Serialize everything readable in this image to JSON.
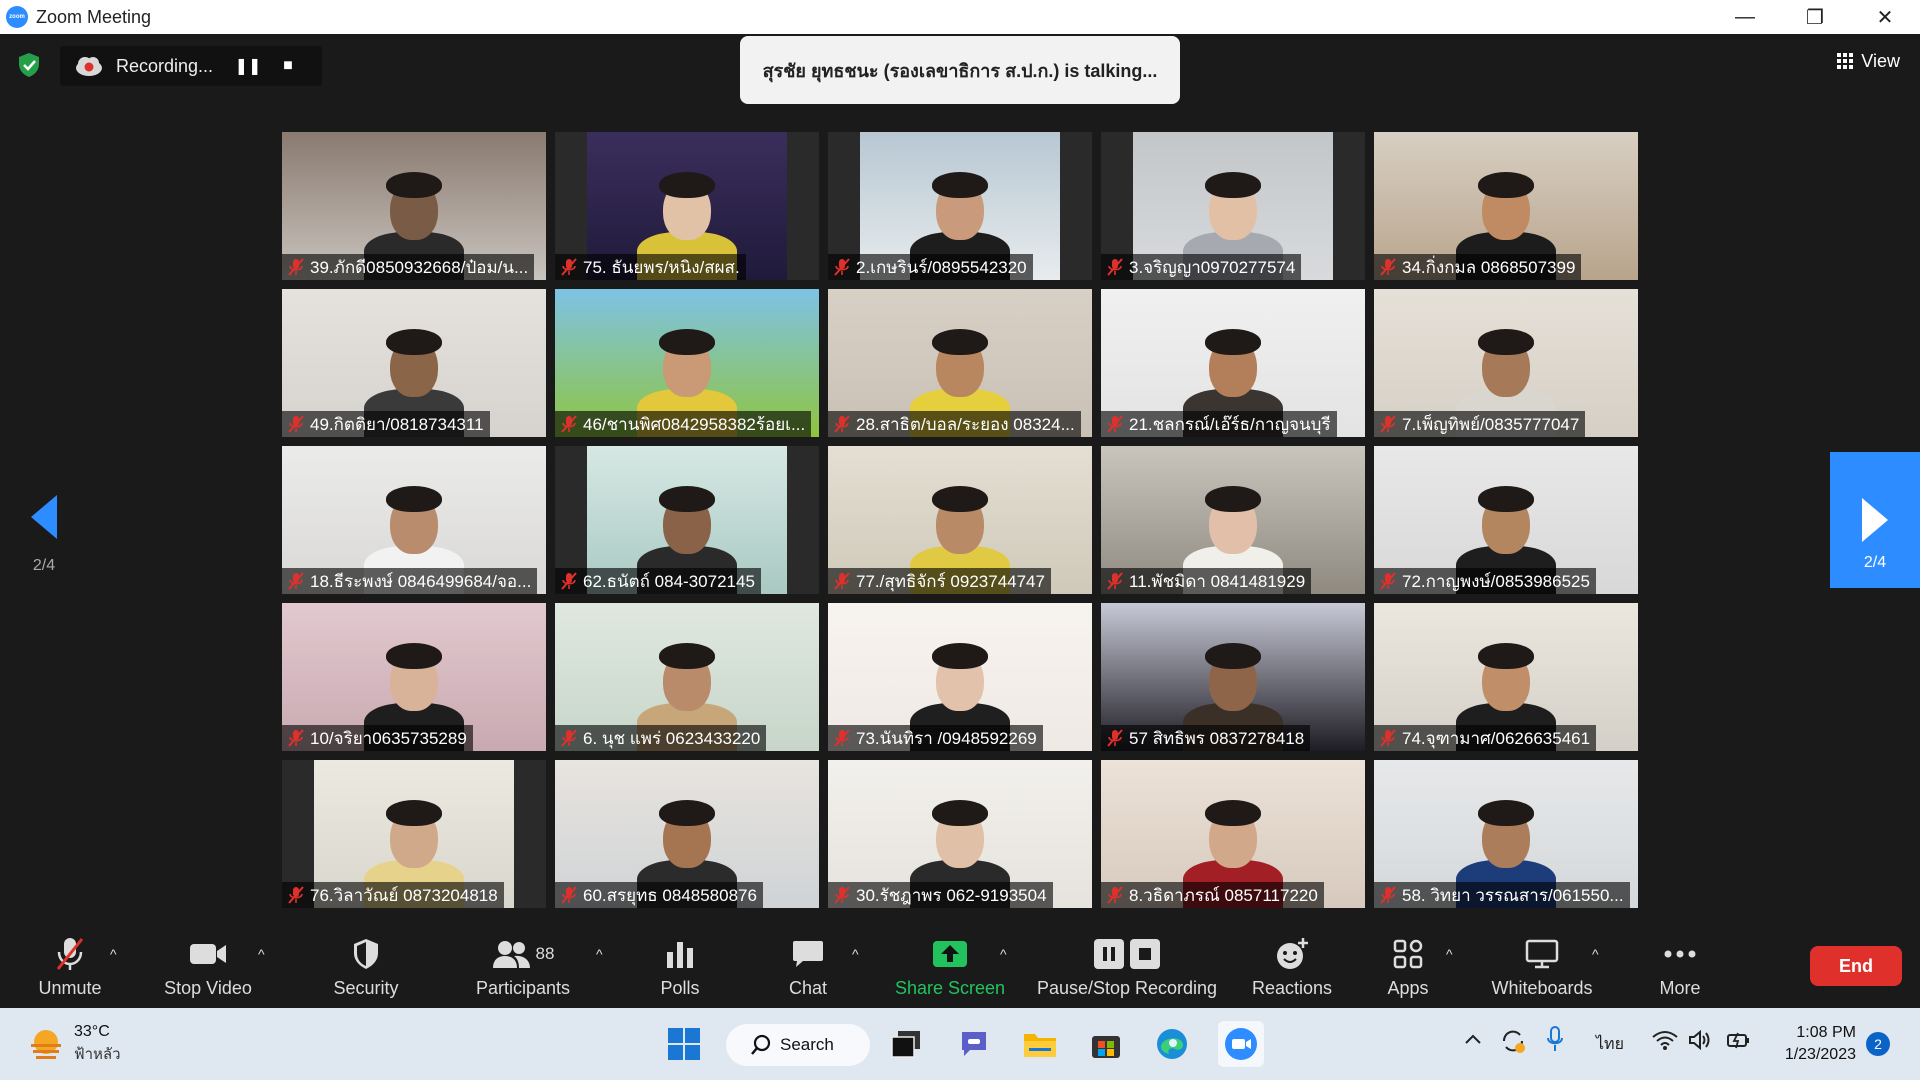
{
  "window": {
    "title": "Zoom Meeting",
    "app_icon_text": "zoom",
    "minimize": "—",
    "restore": "❐",
    "close": "✕"
  },
  "recording": {
    "label": "Recording...",
    "pause_glyph": "❚❚",
    "stop_glyph": "■"
  },
  "talking": "สุรชัย ยุทธชนะ (รองเลขาธิการ ส.ป.ก.) is talking...",
  "view_label": "View",
  "pagination": {
    "left_page": "2/4",
    "right_page": "2/4"
  },
  "participants": [
    {
      "name": "39.ภักดี0850932668/ป๋อม/น...",
      "bg": "#c9c4be",
      "wall": "#8a7a70",
      "skin": "#7a5b45",
      "shirt": "#2a2a2a"
    },
    {
      "name": "75. ธันยพร/หนิง/สผส.",
      "bg": "#1f1a3a",
      "wall": "#3b2e5c",
      "skin": "#e2c2a6",
      "shirt": "#d9c23a"
    },
    {
      "name": "2.เกษรินร์/0895542320",
      "bg": "#e8ecee",
      "wall": "#b7c7d2",
      "skin": "#c99a7c",
      "shirt": "#1d1d1d"
    },
    {
      "name": "3.จริญญา0970277574",
      "bg": "#d8dadc",
      "wall": "#c3c6c9",
      "skin": "#e2c0a6",
      "shirt": "#a6a9b0"
    },
    {
      "name": "34.กิ่งกมล 0868507399",
      "bg": "#b8a48c",
      "wall": "#d8cfc2",
      "skin": "#c08b62",
      "shirt": "#1c1c1c"
    },
    {
      "name": "49.กิตติยา/0818734311",
      "bg": "#d6d3cf",
      "wall": "#e5e2de",
      "skin": "#8a6548",
      "shirt": "#3a3a3a"
    },
    {
      "name": "46/ชานพิศ0842958382ร้อยเ...",
      "bg": "#8fc43f",
      "wall": "#7ec3e6",
      "skin": "#c99a75",
      "shirt": "#e2c83a"
    },
    {
      "name": "28.สาธิต/บอล/ระยอง 08324...",
      "bg": "#c9c1b5",
      "wall": "#d8d0c5",
      "skin": "#b8865f",
      "shirt": "#e5cf3c"
    },
    {
      "name": "21.ชลกรณ์/เอ๊ร์ธ/กาญจนบุรี",
      "bg": "#e3e3e3",
      "wall": "#f0f0f0",
      "skin": "#b27f5a",
      "shirt": "#3a3530"
    },
    {
      "name": "7.เพ็ญทิพย์/0835777047",
      "bg": "#d5cfc5",
      "wall": "#e6e1d8",
      "skin": "#a67a58",
      "shirt": "#d9d6cf"
    },
    {
      "name": "18.ธีระพงษ์ 0846499684/จอ...",
      "bg": "#d9d8d6",
      "wall": "#ebebea",
      "skin": "#b88c6c",
      "shirt": "#f2f2f2"
    },
    {
      "name": "62.ธนัตถ์ 084-3072145",
      "bg": "#a9c9c2",
      "wall": "#d6e8e4",
      "skin": "#8a6247",
      "shirt": "#2a2a2a"
    },
    {
      "name": "77./สุทธิจักร์ 0923744747",
      "bg": "#cfc9b9",
      "wall": "#e4dfd3",
      "skin": "#b98a66",
      "shirt": "#e0ca44"
    },
    {
      "name": "11.พัชมิดา 0841481929",
      "bg": "#8f8a80",
      "wall": "#c9c5bd",
      "skin": "#e1bfa8",
      "shirt": "#f0efe9"
    },
    {
      "name": "72.กาญพงษ์/0853986525",
      "bg": "#d8d8d8",
      "wall": "#e8e8e8",
      "skin": "#b38660",
      "shirt": "#1e1e1e"
    },
    {
      "name": "10/จริยา0635735289",
      "bg": "#c9a9b1",
      "wall": "#e2c9cf",
      "skin": "#d8b39a",
      "shirt": "#1e1e1e"
    },
    {
      "name": "6. นุช แพร่  0623433220",
      "bg": "#c7d6c9",
      "wall": "#e0e8e0",
      "skin": "#b98b6a",
      "shirt": "#c7a77a"
    },
    {
      "name": "73.นันทิรา /0948592269",
      "bg": "#efe9e4",
      "wall": "#f7f3ef",
      "skin": "#e2c2ab",
      "shirt": "#1f1f1f"
    },
    {
      "name": "57 สิทธิพร   0837278418",
      "bg": "#1e1c24",
      "wall": "#c7c9d6",
      "skin": "#8e6549",
      "shirt": "#3b3028"
    },
    {
      "name": "74.จุฑามาศ/0626635461",
      "bg": "#d4d0c8",
      "wall": "#ebe7df",
      "skin": "#c08e68",
      "shirt": "#1e1e1e"
    },
    {
      "name": "76.วิลาวัณย์ 0873204818",
      "bg": "#d9d6cc",
      "wall": "#ece9e1",
      "skin": "#cfa98a",
      "shirt": "#e6d28a"
    },
    {
      "name": "60.สรยุทธ 0848580876",
      "bg": "#cfd3d6",
      "wall": "#e8e4df",
      "skin": "#a57552",
      "shirt": "#2b2b2b"
    },
    {
      "name": "30.รัชฎาพร 062-9193504",
      "bg": "#e6e3de",
      "wall": "#f2f0ec",
      "skin": "#e0c0a6",
      "shirt": "#2a2a2a"
    },
    {
      "name": "8.วธิดาภรณ์ 0857117220",
      "bg": "#d7c9bd",
      "wall": "#ece2d8",
      "skin": "#d2a88a",
      "shirt": "#a11f25"
    },
    {
      "name": "58. วิทยา วรรณสาร/061550...",
      "bg": "#d5d8da",
      "wall": "#e6e8ea",
      "skin": "#ab7d5a",
      "shirt": "#1d3d7a"
    }
  ],
  "toolbar": {
    "unmute": "Unmute",
    "stop_video": "Stop Video",
    "security": "Security",
    "participants": "Participants",
    "participants_count": "88",
    "polls": "Polls",
    "chat": "Chat",
    "share_screen": "Share Screen",
    "pause_stop_recording": "Pause/Stop Recording",
    "reactions": "Reactions",
    "apps": "Apps",
    "whiteboards": "Whiteboards",
    "more": "More",
    "end": "End",
    "caret": "^",
    "share_color": "#22c35e",
    "end_color": "#e0302b"
  },
  "taskbar": {
    "temperature": "33°C",
    "weather_condition": "ฟ้าหลัว",
    "search_label": "Search",
    "language": "ไทย",
    "time": "1:08 PM",
    "date": "1/23/2023",
    "notifications": "2"
  }
}
